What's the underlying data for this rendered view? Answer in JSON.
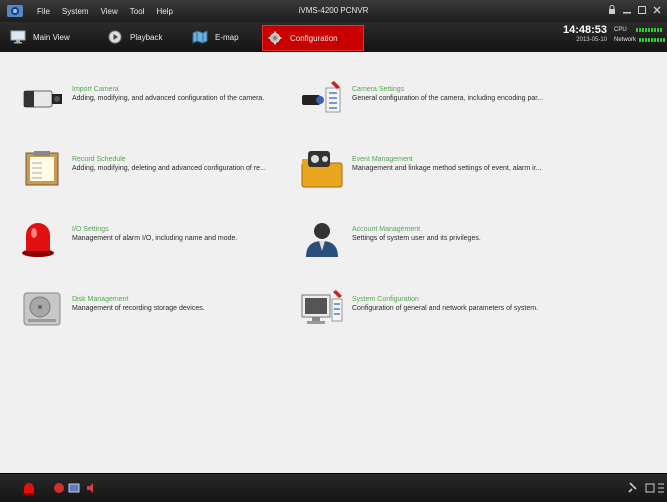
{
  "titlebar": {
    "menus": [
      "File",
      "System",
      "View",
      "Tool",
      "Help"
    ],
    "title": "iVMS-4200 PCNVR"
  },
  "nav": {
    "tabs": [
      {
        "label": "Main View",
        "icon": "monitor-icon",
        "active": false
      },
      {
        "label": "Playback",
        "icon": "playback-icon",
        "active": false
      },
      {
        "label": "E-map",
        "icon": "map-icon",
        "active": false
      },
      {
        "label": "Configuration",
        "icon": "configuration-icon",
        "active": true
      }
    ],
    "time": "14:48:53",
    "date": "2013-05-10",
    "cpu_label": "CPU",
    "network_label": "Network"
  },
  "items": [
    {
      "title": "Import Camera",
      "desc": "Adding, modifying, and advanced configuration of the camera."
    },
    {
      "title": "Camera Settings",
      "desc": "General configuration of the camera, including encoding par..."
    },
    {
      "title": "Record Schedule",
      "desc": "Adding, modifying, deleting and advanced configuration of re..."
    },
    {
      "title": "Event Management",
      "desc": "Management and linkage method settings of event, alarm ir..."
    },
    {
      "title": "I/O Settings",
      "desc": "Management of alarm I/O, including name and mode."
    },
    {
      "title": "Account Management",
      "desc": "Settings of system user and its privileges."
    },
    {
      "title": "Disk Management",
      "desc": "Management of recording storage devices."
    },
    {
      "title": "System Configuration",
      "desc": "Configuration of general and network parameters of system."
    }
  ],
  "colors": {
    "accent": "#c80000",
    "item_title": "#57a657",
    "meter": "#2dd12d"
  }
}
